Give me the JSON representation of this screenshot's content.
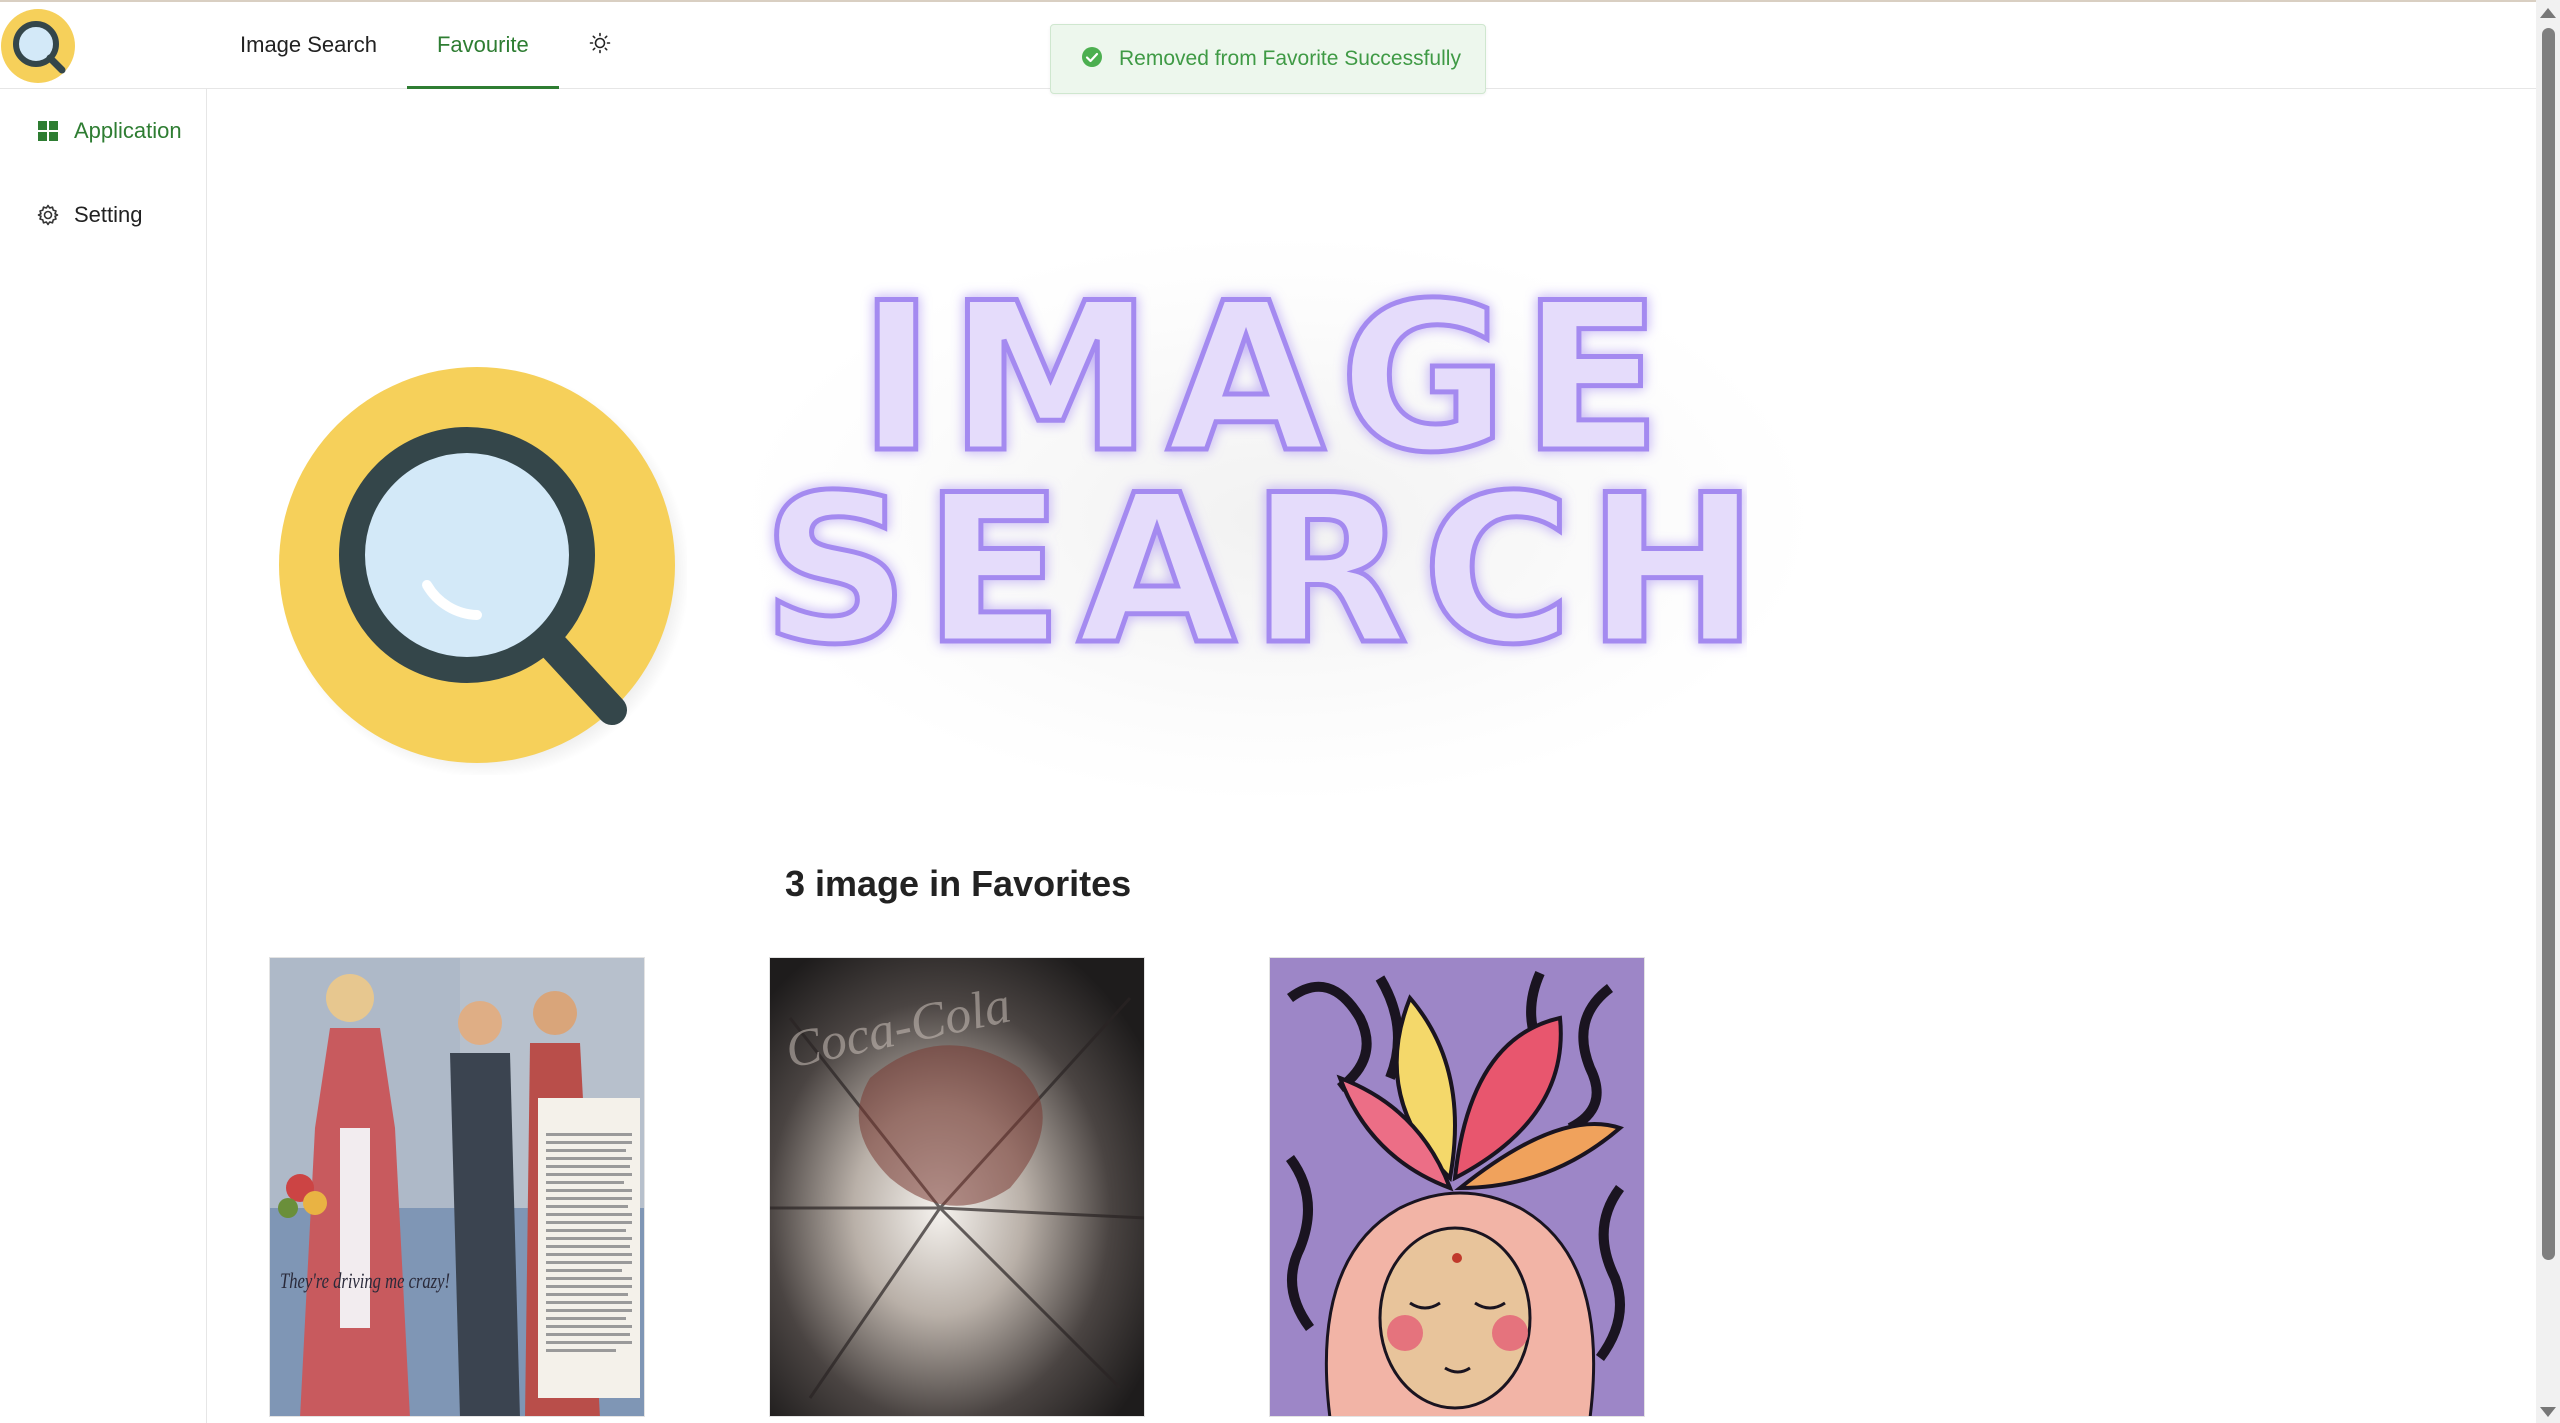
{
  "header": {
    "nav": [
      {
        "label": "Image Search",
        "active": false
      },
      {
        "label": "Favourite",
        "active": true
      }
    ],
    "theme_toggle_icon": "sun-icon"
  },
  "toast": {
    "message": "Removed from Favorite Successfully",
    "icon": "check-circle-icon",
    "color": "#3f9a45"
  },
  "sidebar": {
    "items": [
      {
        "label": "Application",
        "icon": "grid-icon",
        "active": true
      },
      {
        "label": "Setting",
        "icon": "gear-icon",
        "active": false
      }
    ]
  },
  "hero": {
    "line1": "IMAGE",
    "line2": "SEARCH",
    "text_color": "#b39cf0",
    "logo_color": "#f6d05a"
  },
  "favorites": {
    "title": "3 image in Favorites",
    "images": [
      {
        "caption": "They're driving me crazy!"
      },
      {
        "caption": "Coca-Cola"
      },
      {
        "caption": ""
      }
    ]
  },
  "colors": {
    "accent": "#2e7d32"
  }
}
